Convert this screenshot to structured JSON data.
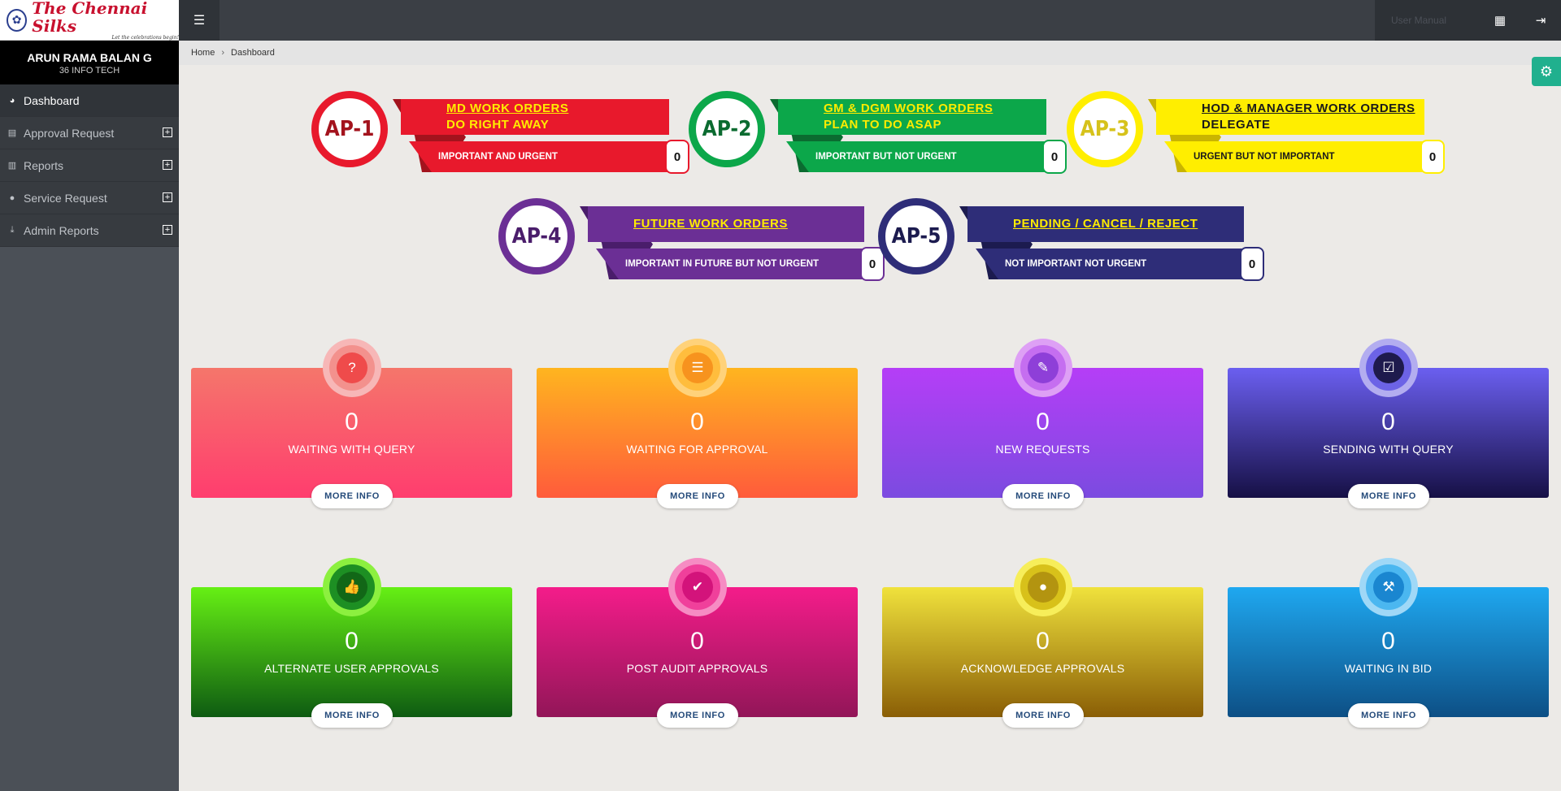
{
  "brand": {
    "name": "The Chennai Silks",
    "tagline": "Let the celebrations begin!"
  },
  "user": {
    "name": "ARUN RAMA BALAN G",
    "org": "36 INFO TECH"
  },
  "sidebar": {
    "items": [
      {
        "label": "Dashboard",
        "icon": "dashboard-icon"
      },
      {
        "label": "Approval Request",
        "icon": "list-icon"
      },
      {
        "label": "Reports",
        "icon": "bar-chart-icon"
      },
      {
        "label": "Service Request",
        "icon": "comments-icon"
      },
      {
        "label": "Admin Reports",
        "icon": "download-icon"
      }
    ]
  },
  "topbar": {
    "user_badge": "User Manual"
  },
  "breadcrumb": {
    "home": "Home",
    "current": "Dashboard"
  },
  "priorities": [
    {
      "code": "AP-1",
      "line1": "MD WORK ORDERS",
      "line2": "DO RIGHT AWAY",
      "sub": "IMPORTANT AND URGENT",
      "count": "0",
      "color": "#e8192c",
      "dark": "#a3131d",
      "text": "#ffec00"
    },
    {
      "code": "AP-2",
      "line1": "GM & DGM WORK ORDERS",
      "line2": "PLAN TO DO ASAP",
      "sub": "IMPORTANT BUT NOT URGENT",
      "count": "0",
      "color": "#0ca74a",
      "dark": "#0b6b30",
      "text": "#ffec00"
    },
    {
      "code": "AP-3",
      "line1": "HOD & MANAGER WORK ORDERS",
      "line2": "DELEGATE",
      "sub": "URGENT BUT NOT IMPORTANT",
      "count": "0",
      "color": "#ffee00",
      "dark": "#c9b400",
      "text": "#1a1a1a"
    },
    {
      "code": "AP-4",
      "line1": "FUTURE WORK ORDERS",
      "line2": "",
      "sub": "IMPORTANT IN FUTURE BUT NOT URGENT",
      "count": "0",
      "color": "#6b2f95",
      "dark": "#4a1d6b",
      "text": "#ffec00"
    },
    {
      "code": "AP-5",
      "line1": "PENDING / CANCEL / REJECT",
      "line2": "",
      "sub": "NOT IMPORTANT NOT URGENT",
      "count": "0",
      "color": "#2e2d78",
      "dark": "#1c1b4f",
      "text": "#ffec00"
    }
  ],
  "cards": [
    {
      "value": "0",
      "label": "WAITING WITH QUERY",
      "more": "MORE INFO",
      "icon": "question-icon",
      "glyph": "?",
      "grad": [
        "#f5766b",
        "#ff3d6e"
      ],
      "halo": "#f7b7b7",
      "ring": "#f3918d",
      "inner": "#ef4b4b"
    },
    {
      "value": "0",
      "label": "WAITING FOR APPROVAL",
      "more": "MORE INFO",
      "icon": "list-alt-icon",
      "glyph": "☰",
      "grad": [
        "#ffb51f",
        "#ff5b3b"
      ],
      "halo": "#ffd27a",
      "ring": "#ffbd3d",
      "inner": "#f7931e"
    },
    {
      "value": "0",
      "label": "NEW REQUESTS",
      "more": "MORE INFO",
      "icon": "edit-icon",
      "glyph": "✎",
      "grad": [
        "#b53ef7",
        "#7b4be0"
      ],
      "halo": "#dea0f5",
      "ring": "#c56ef0",
      "inner": "#8e3fd8"
    },
    {
      "value": "0",
      "label": "SENDING WITH QUERY",
      "more": "MORE INFO",
      "icon": "check-square-icon",
      "glyph": "☑",
      "grad": [
        "#6b5ff0",
        "#161045"
      ],
      "halo": "#b3adf0",
      "ring": "#6c63e6",
      "inner": "#1e1a4d"
    },
    {
      "value": "0",
      "label": "ALTERNATE USER APPROVALS",
      "more": "MORE INFO",
      "icon": "thumbs-up-icon",
      "glyph": "👍",
      "grad": [
        "#66f014",
        "#0e5b12"
      ],
      "halo": "#8cf03f",
      "ring": "#1d8f23",
      "inner": "#126717"
    },
    {
      "value": "0",
      "label": "POST AUDIT APPROVALS",
      "more": "MORE INFO",
      "icon": "check-circle-icon",
      "glyph": "✔",
      "grad": [
        "#f41c8a",
        "#921658"
      ],
      "halo": "#f68cc3",
      "ring": "#f0409b",
      "inner": "#d3137b"
    },
    {
      "value": "0",
      "label": "ACKNOWLEDGE APPROVALS",
      "more": "MORE INFO",
      "icon": "user-icon",
      "glyph": "●",
      "grad": [
        "#f0e23c",
        "#8a5e06"
      ],
      "halo": "#f7ee5a",
      "ring": "#d8c11a",
      "inner": "#b39410"
    },
    {
      "value": "0",
      "label": "WAITING IN BID",
      "more": "MORE INFO",
      "icon": "gavel-icon",
      "glyph": "⚒",
      "grad": [
        "#1fa8f0",
        "#0d4f85"
      ],
      "halo": "#9fd8f7",
      "ring": "#4bb7f0",
      "inner": "#1a86d0"
    }
  ]
}
